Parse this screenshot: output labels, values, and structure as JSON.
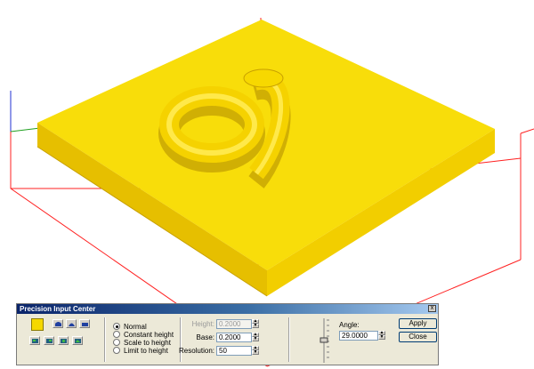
{
  "panel": {
    "title": "Precision Input Center",
    "close_glyph": "x",
    "swatch_color": "#f5d800",
    "mode_icons": [
      "arch-shape-icon",
      "dome-shape-icon",
      "flat-shape-icon"
    ],
    "style_icons": [
      "style-1-icon",
      "style-2-icon",
      "style-3-icon",
      "style-4-icon"
    ],
    "radios": [
      {
        "label": "Normal",
        "selected": true
      },
      {
        "label": "Constant height",
        "selected": false
      },
      {
        "label": "Scale to height",
        "selected": false
      },
      {
        "label": "Limit to height",
        "selected": false
      }
    ],
    "height_label": "Height:",
    "height_value": "0.2000",
    "base_label": "Base:",
    "base_value": "0.2000",
    "resolution_label": "Resolution:",
    "resolution_value": "50",
    "angle_label": "Angle:",
    "angle_value": "29.0000",
    "apply_label": "Apply",
    "close_label": "Close"
  },
  "scene": {
    "object_color": "#f5d800",
    "bbox_color": "#ff2020",
    "embossed_glyph": "a"
  }
}
